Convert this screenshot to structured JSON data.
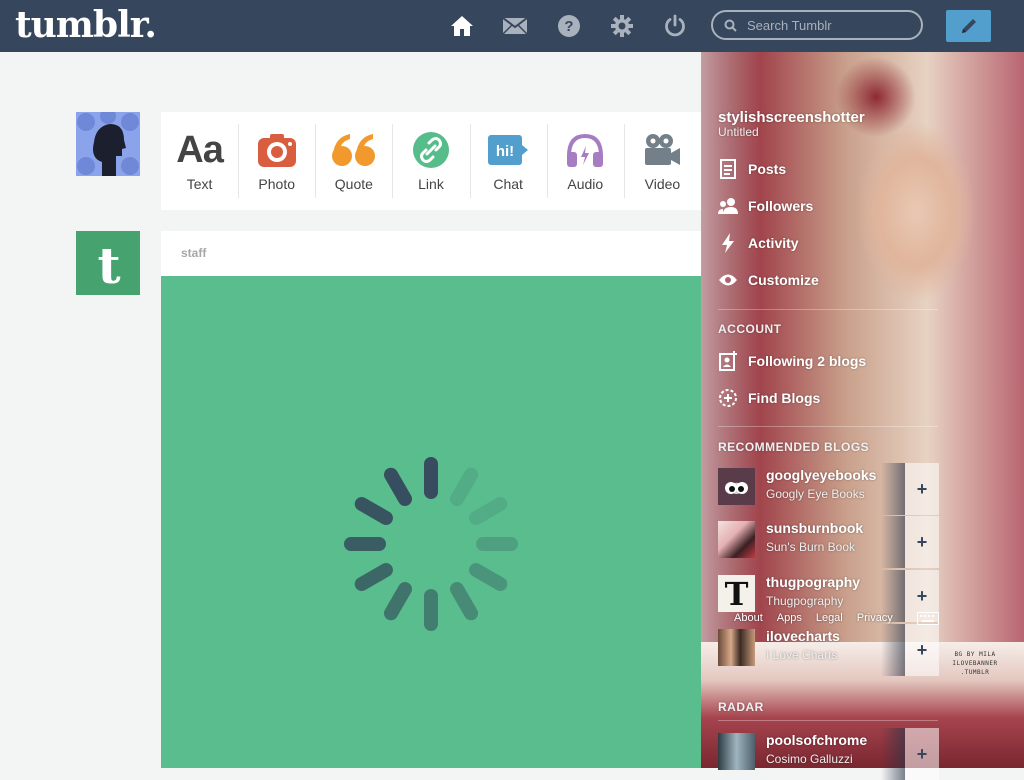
{
  "topbar": {
    "logo": "tumblr.",
    "search_placeholder": "Search Tumblr",
    "icons": [
      "home-icon",
      "mail-icon",
      "help-icon",
      "gear-icon",
      "power-icon",
      "pencil-icon"
    ]
  },
  "post_types": [
    {
      "label": "Text",
      "color": "#444444"
    },
    {
      "label": "Photo",
      "color": "#d95e40"
    },
    {
      "label": "Quote",
      "color": "#f2992e"
    },
    {
      "label": "Link",
      "color": "#56bc8a"
    },
    {
      "label": "Chat",
      "color": "#529ecc"
    },
    {
      "label": "Audio",
      "color": "#a77dc2"
    },
    {
      "label": "Video",
      "color": "#748089"
    }
  ],
  "post": {
    "author": "staff",
    "media_color": "#59bd8d"
  },
  "sidebar": {
    "blog_title": "stylishscreenshotter",
    "blog_subtitle": "Untitled",
    "menu": [
      "Posts",
      "Followers",
      "Activity",
      "Customize"
    ],
    "account_heading": "ACCOUNT",
    "account_items": [
      "Following 2 blogs",
      "Find Blogs"
    ],
    "recommended_heading": "RECOMMENDED BLOGS",
    "recommended": [
      {
        "name": "googlyeyebooks",
        "subtitle": "Googly Eye Books"
      },
      {
        "name": "sunsburnbook",
        "subtitle": "Sun's Burn Book"
      },
      {
        "name": "thugpography",
        "subtitle": "Thugpography"
      },
      {
        "name": "ilovecharts",
        "subtitle": "I Love Charts"
      }
    ],
    "footer_links": [
      "About",
      "Apps",
      "Legal",
      "Privacy"
    ],
    "radar_heading": "RADAR",
    "radar": {
      "name": "poolsofchrome",
      "subtitle": "Cosimo Galluzzi"
    }
  },
  "background_credit": [
    "BG BY MILA",
    "ILOVEBANNER",
    ".TUMBLR"
  ],
  "colors": {
    "topbar": "#36465d",
    "accent": "#529ecc",
    "page_bg": "#f3f4f4"
  }
}
